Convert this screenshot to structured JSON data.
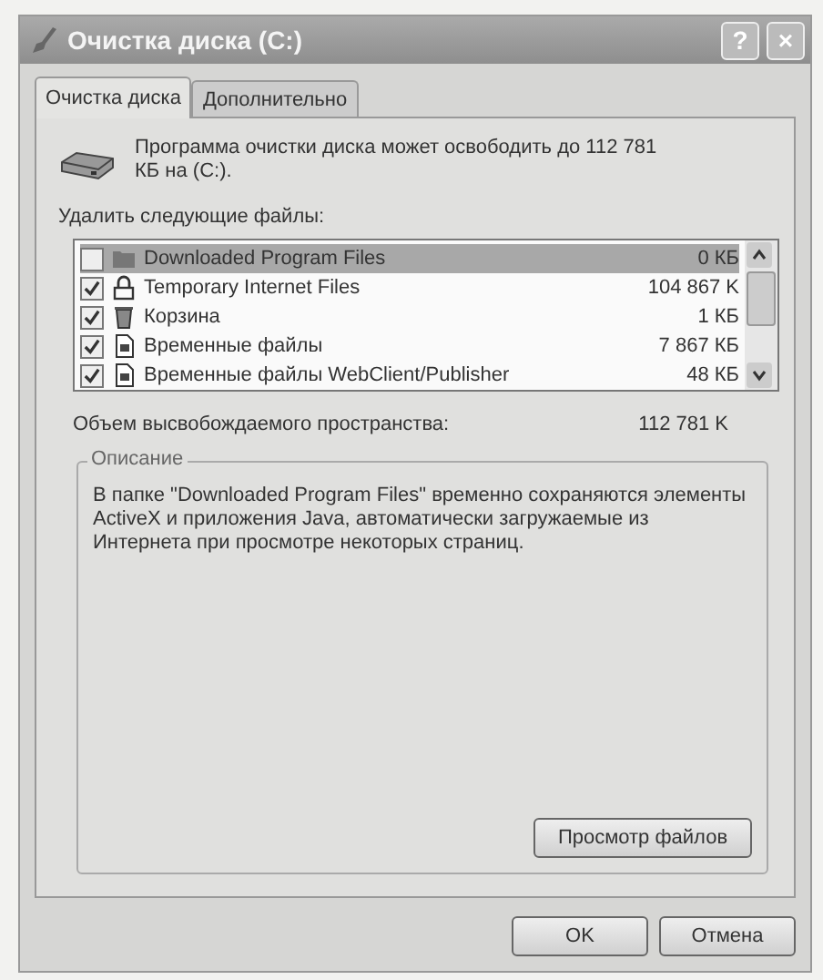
{
  "window": {
    "title": "Очистка диска  (C:)",
    "help": "?",
    "close": "×"
  },
  "tabs": [
    {
      "label": "Очистка диска",
      "selected": true
    },
    {
      "label": "Дополнительно",
      "selected": false
    }
  ],
  "intro": "Программа очистки диска может освободить до 112 781 КБ на  (C:).",
  "list_label": "Удалить следующие файлы:",
  "files": [
    {
      "name": "Downloaded Program Files",
      "size": "0 КБ",
      "checked": false,
      "selected": true,
      "kind": "folder"
    },
    {
      "name": "Temporary Internet Files",
      "size": "104 867 K",
      "checked": true,
      "selected": false,
      "kind": "lock"
    },
    {
      "name": "Корзина",
      "size": "1 КБ",
      "checked": true,
      "selected": false,
      "kind": "bin"
    },
    {
      "name": "Временные файлы",
      "size": "7 867 КБ",
      "checked": true,
      "selected": false,
      "kind": "file"
    },
    {
      "name": "Временные файлы WebClient/Publisher",
      "size": "48 КБ",
      "checked": true,
      "selected": false,
      "kind": "file"
    }
  ],
  "total": {
    "label": "Объем высвобождаемого пространства:",
    "value": "112 781 K"
  },
  "description": {
    "title": "Описание",
    "text": "В папке \"Downloaded Program Files\" временно сохраняются элементы ActiveX и приложения Java, автоматически загружаемые из Интернета при просмотре некоторых страниц.",
    "button": "Просмотр файлов"
  },
  "buttons": [
    "OK",
    "Отмена"
  ]
}
